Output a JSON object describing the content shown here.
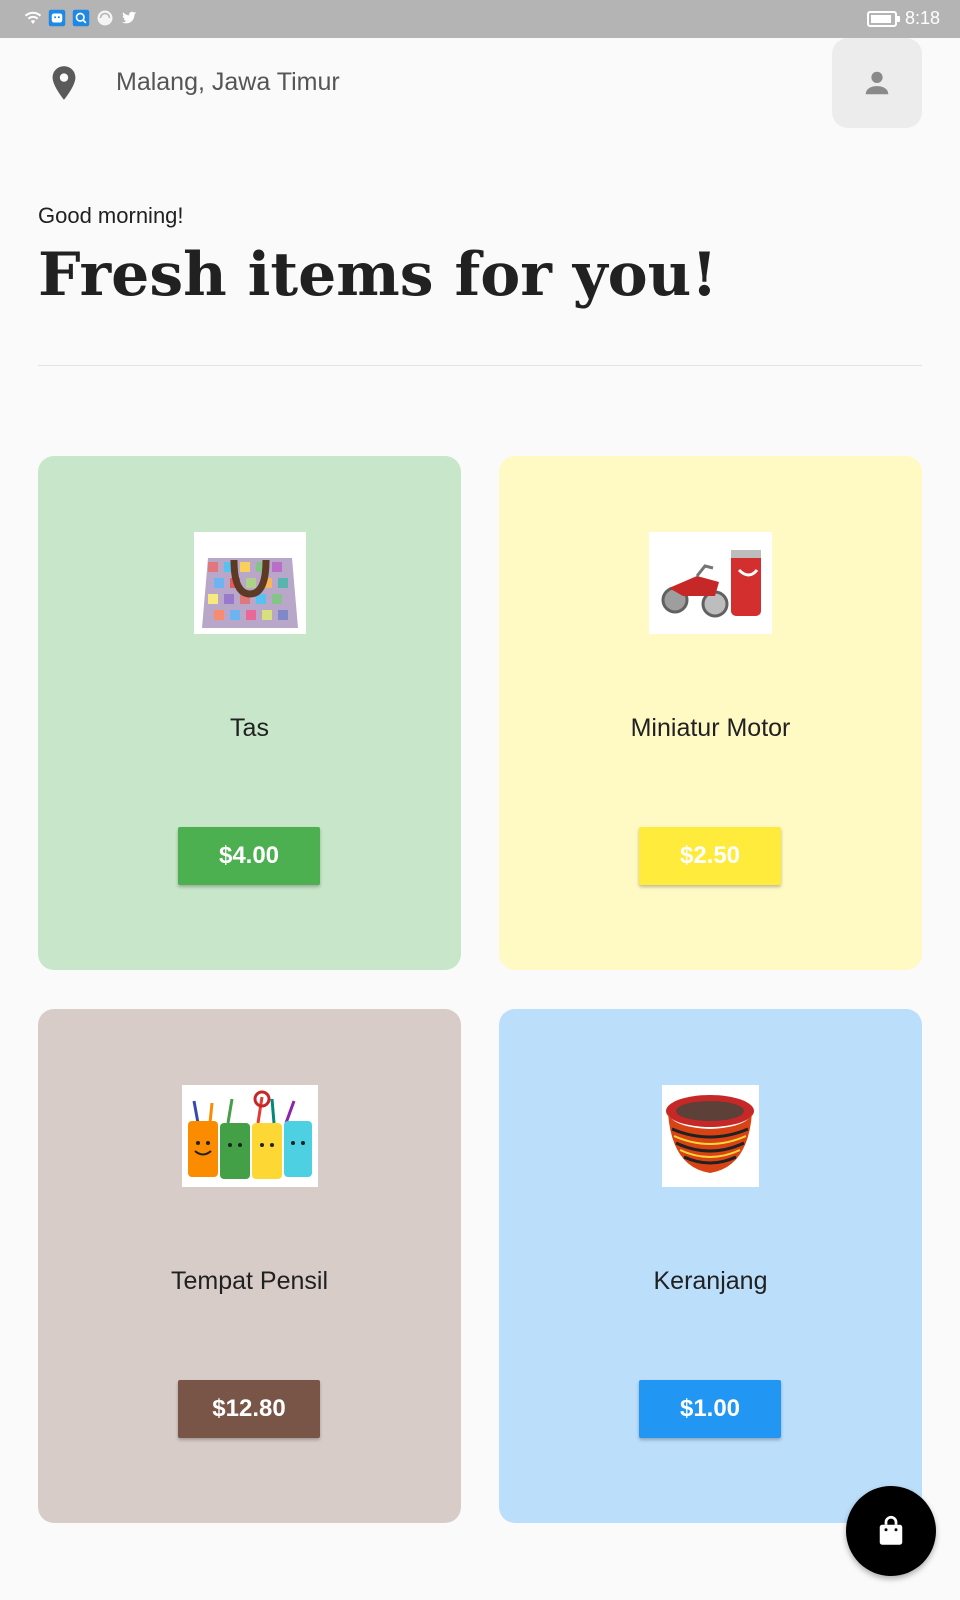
{
  "status_bar": {
    "time": "8:18",
    "icons": [
      "wifi-icon",
      "notification-app-icon",
      "search-app-icon",
      "browser-icon",
      "twitter-icon"
    ]
  },
  "header": {
    "location": "Malang, Jawa Timur",
    "location_icon": "location-pin-icon",
    "profile_icon": "person-icon"
  },
  "greeting": "Good morning!",
  "headline": "Fresh items for you!",
  "items": [
    {
      "name": "Tas",
      "price": "$4.00",
      "bg": "#c8e6c9",
      "button_color": "#4caf50",
      "image": "woven-bag-photo"
    },
    {
      "name": "Miniatur Motor",
      "price": "$2.50",
      "bg": "#fff9c4",
      "button_color": "#ffeb3b",
      "image": "can-motorcycle-photo"
    },
    {
      "name": "Tempat Pensil",
      "price": "$12.80",
      "bg": "#d7ccc8",
      "button_color": "#795548",
      "image": "pencil-holders-photo"
    },
    {
      "name": "Keranjang",
      "price": "$1.00",
      "bg": "#bbdefb",
      "button_color": "#2196f3",
      "image": "woven-basket-photo"
    }
  ],
  "cart_icon": "shopping-bag-icon"
}
